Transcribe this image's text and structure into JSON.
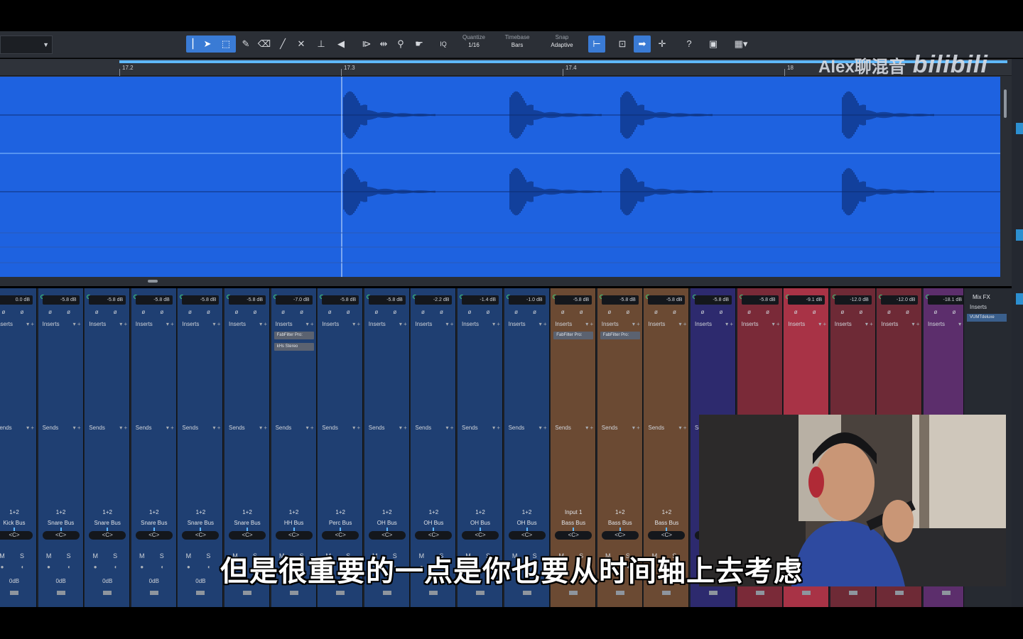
{
  "toolbar": {
    "left_dropdown_value": "",
    "tools": [
      "select-tool",
      "range-tool",
      "paint-tool",
      "eraser-tool",
      "draw-tool",
      "mute-tool",
      "split-tool",
      "listen-tool",
      "bend-tool",
      "scissor-tool",
      "zoom-tool",
      "hand-tool"
    ],
    "iq": "IQ",
    "quantize_label": "Quantize",
    "quantize_value": "1/16",
    "timebase_label": "Timebase",
    "timebase_value": "Bars",
    "snap_label": "Snap",
    "snap_value": "Adaptive",
    "help": "?"
  },
  "ruler": {
    "marks": [
      "17.2",
      "17.3",
      "17.4",
      "18"
    ]
  },
  "watermark": {
    "text": "Alex聊混音",
    "logo": "bilibili"
  },
  "channels": [
    {
      "db": "0.0 dB",
      "io": "1+2",
      "bus": "Kick Bus",
      "gain": "0dB",
      "plugins": [],
      "color": "#1f3f72"
    },
    {
      "db": "-5.8 dB",
      "io": "1+2",
      "bus": "Snare Bus",
      "gain": "0dB",
      "plugins": [],
      "color": "#1f3f72"
    },
    {
      "db": "-5.8 dB",
      "io": "1+2",
      "bus": "Snare Bus",
      "gain": "0dB",
      "plugins": [],
      "color": "#1f3f72"
    },
    {
      "db": "-5.8 dB",
      "io": "1+2",
      "bus": "Snare Bus",
      "gain": "0dB",
      "plugins": [],
      "color": "#1f3f72"
    },
    {
      "db": "-5.8 dB",
      "io": "1+2",
      "bus": "Snare Bus",
      "gain": "0dB",
      "plugins": [],
      "color": "#1f3f72"
    },
    {
      "db": "-5.8 dB",
      "io": "1+2",
      "bus": "Snare Bus",
      "gain": "",
      "plugins": [],
      "color": "#1f3f72"
    },
    {
      "db": "-7.0 dB",
      "io": "1+2",
      "bus": "HH Bus",
      "gain": "",
      "plugins": [
        "FabFilter Pro:",
        "kHs Stereo"
      ],
      "color": "#1f3f72"
    },
    {
      "db": "-5.8 dB",
      "io": "1+2",
      "bus": "Perc Bus",
      "gain": "",
      "plugins": [],
      "color": "#1f3f72"
    },
    {
      "db": "-5.8 dB",
      "io": "1+2",
      "bus": "OH Bus",
      "gain": "",
      "plugins": [],
      "color": "#1f3f72"
    },
    {
      "db": "-2.2 dB",
      "io": "1+2",
      "bus": "OH Bus",
      "gain": "",
      "plugins": [],
      "color": "#1f3f72"
    },
    {
      "db": "-1.4 dB",
      "io": "1+2",
      "bus": "OH Bus",
      "gain": "",
      "plugins": [],
      "color": "#1f3f72"
    },
    {
      "db": "-1.0 dB",
      "io": "1+2",
      "bus": "OH Bus",
      "gain": "",
      "plugins": [],
      "color": "#1f3f72"
    },
    {
      "db": "-5.8 dB",
      "io": "Input 1",
      "bus": "Bass Bus",
      "gain": "",
      "plugins": [
        "FabFilter Pro:"
      ],
      "color": "#6b4a33"
    },
    {
      "db": "-5.8 dB",
      "io": "1+2",
      "bus": "Bass Bus",
      "gain": "",
      "plugins": [
        "FabFilter Pro:"
      ],
      "color": "#6b4a33"
    },
    {
      "db": "-5.8 dB",
      "io": "1+2",
      "bus": "Bass Bus",
      "gain": "",
      "plugins": [],
      "color": "#6b4a33"
    },
    {
      "db": "-5.8 dB",
      "io": "",
      "bus": "",
      "gain": "",
      "plugins": [],
      "color": "#2d2a6e"
    },
    {
      "db": "-5.8 dB",
      "io": "",
      "bus": "",
      "gain": "",
      "plugins": [],
      "color": "#7a2a38"
    },
    {
      "db": "-9.1 dB",
      "io": "",
      "bus": "",
      "gain": "",
      "plugins": [],
      "color": "#a83346"
    },
    {
      "db": "-12.0 dB",
      "io": "",
      "bus": "",
      "gain": "",
      "plugins": [],
      "color": "#6e2a36"
    },
    {
      "db": "-12.0 dB",
      "io": "",
      "bus": "",
      "gain": "",
      "plugins": [],
      "color": "#6e2a36"
    },
    {
      "db": "-18.1 dB",
      "io": "",
      "bus": "",
      "gain": "",
      "plugins": [],
      "color": "#5c2e6c"
    }
  ],
  "labels": {
    "inserts": "Inserts",
    "sends": "Sends",
    "pan": "<C>",
    "mute": "M",
    "solo": "S"
  },
  "mixfx": {
    "title": "Mix FX",
    "inserts": "Inserts",
    "plugin": "VUMTdeluxe"
  },
  "subtitle": "但是很重要的一点是你也要从时间轴上去考虑"
}
